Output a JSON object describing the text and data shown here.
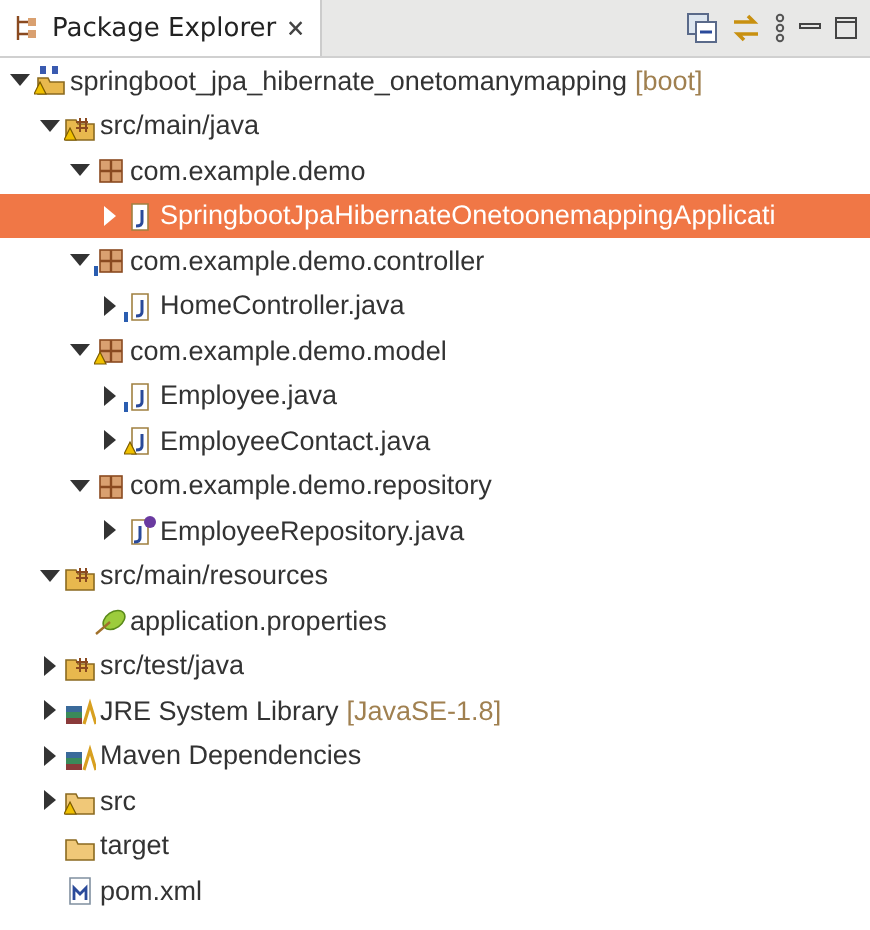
{
  "view": {
    "title": "Package Explorer",
    "close": "🗙"
  },
  "tree": [
    {
      "label": "springboot_jpa_hibernate_onetomanymapping",
      "suffix": "[boot]",
      "kind": "project",
      "warning": true,
      "expanded": true,
      "selected": false,
      "children": [
        {
          "label": "src/main/java",
          "kind": "srcfolder",
          "warning": true,
          "expanded": true,
          "selected": false,
          "children": [
            {
              "label": "com.example.demo",
              "kind": "package",
              "expanded": true,
              "selected": false,
              "children": [
                {
                  "label": "SpringbootJpaHibernateOnetoonemappingApplicati",
                  "kind": "java",
                  "expanded": false,
                  "selected": true
                }
              ]
            },
            {
              "label": "com.example.demo.controller",
              "kind": "package",
              "info": true,
              "expanded": true,
              "selected": false,
              "children": [
                {
                  "label": "HomeController.java",
                  "kind": "java",
                  "info": true,
                  "expanded": false,
                  "selected": false
                }
              ]
            },
            {
              "label": "com.example.demo.model",
              "kind": "package",
              "warning": true,
              "expanded": true,
              "selected": false,
              "children": [
                {
                  "label": "Employee.java",
                  "kind": "java",
                  "info": true,
                  "expanded": false,
                  "selected": false
                },
                {
                  "label": "EmployeeContact.java",
                  "kind": "java",
                  "warning": true,
                  "expanded": false,
                  "selected": false
                }
              ]
            },
            {
              "label": "com.example.demo.repository",
              "kind": "package",
              "expanded": true,
              "selected": false,
              "children": [
                {
                  "label": "EmployeeRepository.java",
                  "kind": "interface",
                  "expanded": false,
                  "selected": false
                }
              ]
            }
          ]
        },
        {
          "label": "src/main/resources",
          "kind": "srcfolder",
          "expanded": true,
          "selected": false,
          "children": [
            {
              "label": "application.properties",
              "kind": "properties",
              "selected": false
            }
          ]
        },
        {
          "label": "src/test/java",
          "kind": "srcfolder",
          "expanded": false,
          "selected": false
        },
        {
          "label": "JRE System Library",
          "suffix": "[JavaSE-1.8]",
          "kind": "library",
          "expanded": false,
          "selected": false
        },
        {
          "label": "Maven Dependencies",
          "kind": "library",
          "expanded": false,
          "selected": false
        },
        {
          "label": "src",
          "kind": "folder",
          "warning": true,
          "expanded": false,
          "selected": false
        },
        {
          "label": "target",
          "kind": "folder",
          "selected": false
        },
        {
          "label": "pom.xml",
          "kind": "xml",
          "selected": false
        }
      ]
    }
  ]
}
